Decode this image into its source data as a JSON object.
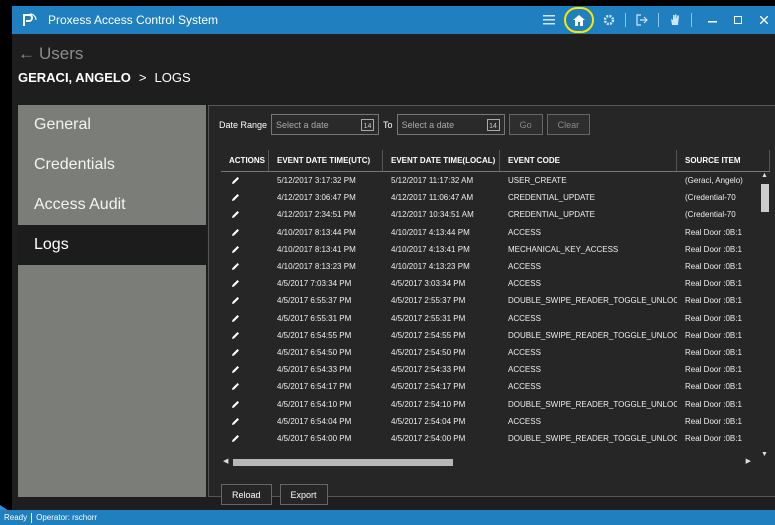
{
  "window": {
    "title": "Proxess Access Control System"
  },
  "header": {
    "back_label": "Users",
    "user_name": "GERACI, ANGELO",
    "separator": ">",
    "current_page": "LOGS"
  },
  "sidebar": {
    "items": [
      {
        "label": "General"
      },
      {
        "label": "Credentials"
      },
      {
        "label": "Access Audit"
      },
      {
        "label": "Logs"
      }
    ]
  },
  "filters": {
    "date_range_label": "Date Range",
    "from_placeholder": "Select a date",
    "to_label": "To",
    "to_placeholder": "Select a date",
    "calendar_day": "14",
    "go_label": "Go",
    "clear_label": "Clear"
  },
  "table": {
    "headers": [
      "ACTIONS",
      "EVENT DATE TIME(UTC)",
      "EVENT DATE TIME(LOCAL)",
      "EVENT CODE",
      "SOURCE ITEM"
    ],
    "rows": [
      {
        "utc": "5/12/2017 3:17:32 PM",
        "local": "5/12/2017 11:17:32 AM",
        "code": "USER_CREATE",
        "source": "(Geraci, Angelo)"
      },
      {
        "utc": "4/12/2017 3:06:47 PM",
        "local": "4/12/2017 11:06:47 AM",
        "code": "CREDENTIAL_UPDATE",
        "source": "(Credential-70"
      },
      {
        "utc": "4/12/2017 2:34:51 PM",
        "local": "4/12/2017 10:34:51 AM",
        "code": "CREDENTIAL_UPDATE",
        "source": "(Credential-70"
      },
      {
        "utc": "4/10/2017 8:13:44 PM",
        "local": "4/10/2017 4:13:44 PM",
        "code": "ACCESS",
        "source": "Real Door :0B:1"
      },
      {
        "utc": "4/10/2017 8:13:41 PM",
        "local": "4/10/2017 4:13:41 PM",
        "code": "MECHANICAL_KEY_ACCESS",
        "source": "Real Door :0B:1"
      },
      {
        "utc": "4/10/2017 8:13:23 PM",
        "local": "4/10/2017 4:13:23 PM",
        "code": "ACCESS",
        "source": "Real Door :0B:1"
      },
      {
        "utc": "4/5/2017 7:03:34 PM",
        "local": "4/5/2017 3:03:34 PM",
        "code": "ACCESS",
        "source": "Real Door :0B:1"
      },
      {
        "utc": "4/5/2017 6:55:37 PM",
        "local": "4/5/2017 2:55:37 PM",
        "code": "DOUBLE_SWIPE_READER_TOGGLE_UNLOCK",
        "source": "Real Door :0B:1"
      },
      {
        "utc": "4/5/2017 6:55:31 PM",
        "local": "4/5/2017 2:55:31 PM",
        "code": "ACCESS",
        "source": "Real Door :0B:1"
      },
      {
        "utc": "4/5/2017 6:54:55 PM",
        "local": "4/5/2017 2:54:55 PM",
        "code": "DOUBLE_SWIPE_READER_TOGGLE_UNLOCK",
        "source": "Real Door :0B:1"
      },
      {
        "utc": "4/5/2017 6:54:50 PM",
        "local": "4/5/2017 2:54:50 PM",
        "code": "ACCESS",
        "source": "Real Door :0B:1"
      },
      {
        "utc": "4/5/2017 6:54:33 PM",
        "local": "4/5/2017 2:54:33 PM",
        "code": "ACCESS",
        "source": "Real Door :0B:1"
      },
      {
        "utc": "4/5/2017 6:54:17 PM",
        "local": "4/5/2017 2:54:17 PM",
        "code": "ACCESS",
        "source": "Real Door :0B:1"
      },
      {
        "utc": "4/5/2017 6:54:10 PM",
        "local": "4/5/2017 2:54:10 PM",
        "code": "DOUBLE_SWIPE_READER_TOGGLE_UNLOCK",
        "source": "Real Door :0B:1"
      },
      {
        "utc": "4/5/2017 6:54:04 PM",
        "local": "4/5/2017 2:54:04 PM",
        "code": "ACCESS",
        "source": "Real Door :0B:1"
      },
      {
        "utc": "4/5/2017 6:54:00 PM",
        "local": "4/5/2017 2:54:00 PM",
        "code": "DOUBLE_SWIPE_READER_TOGGLE_UNLOCK",
        "source": "Real Door :0B:1"
      }
    ]
  },
  "actions": {
    "reload_label": "Reload",
    "export_label": "Export"
  },
  "status": {
    "state": "Ready",
    "operator": "Operator: rschorr"
  },
  "colors": {
    "titlebar": "#1f7fbf",
    "highlight": "#ffe400",
    "sidebar": "#7a7d78"
  }
}
